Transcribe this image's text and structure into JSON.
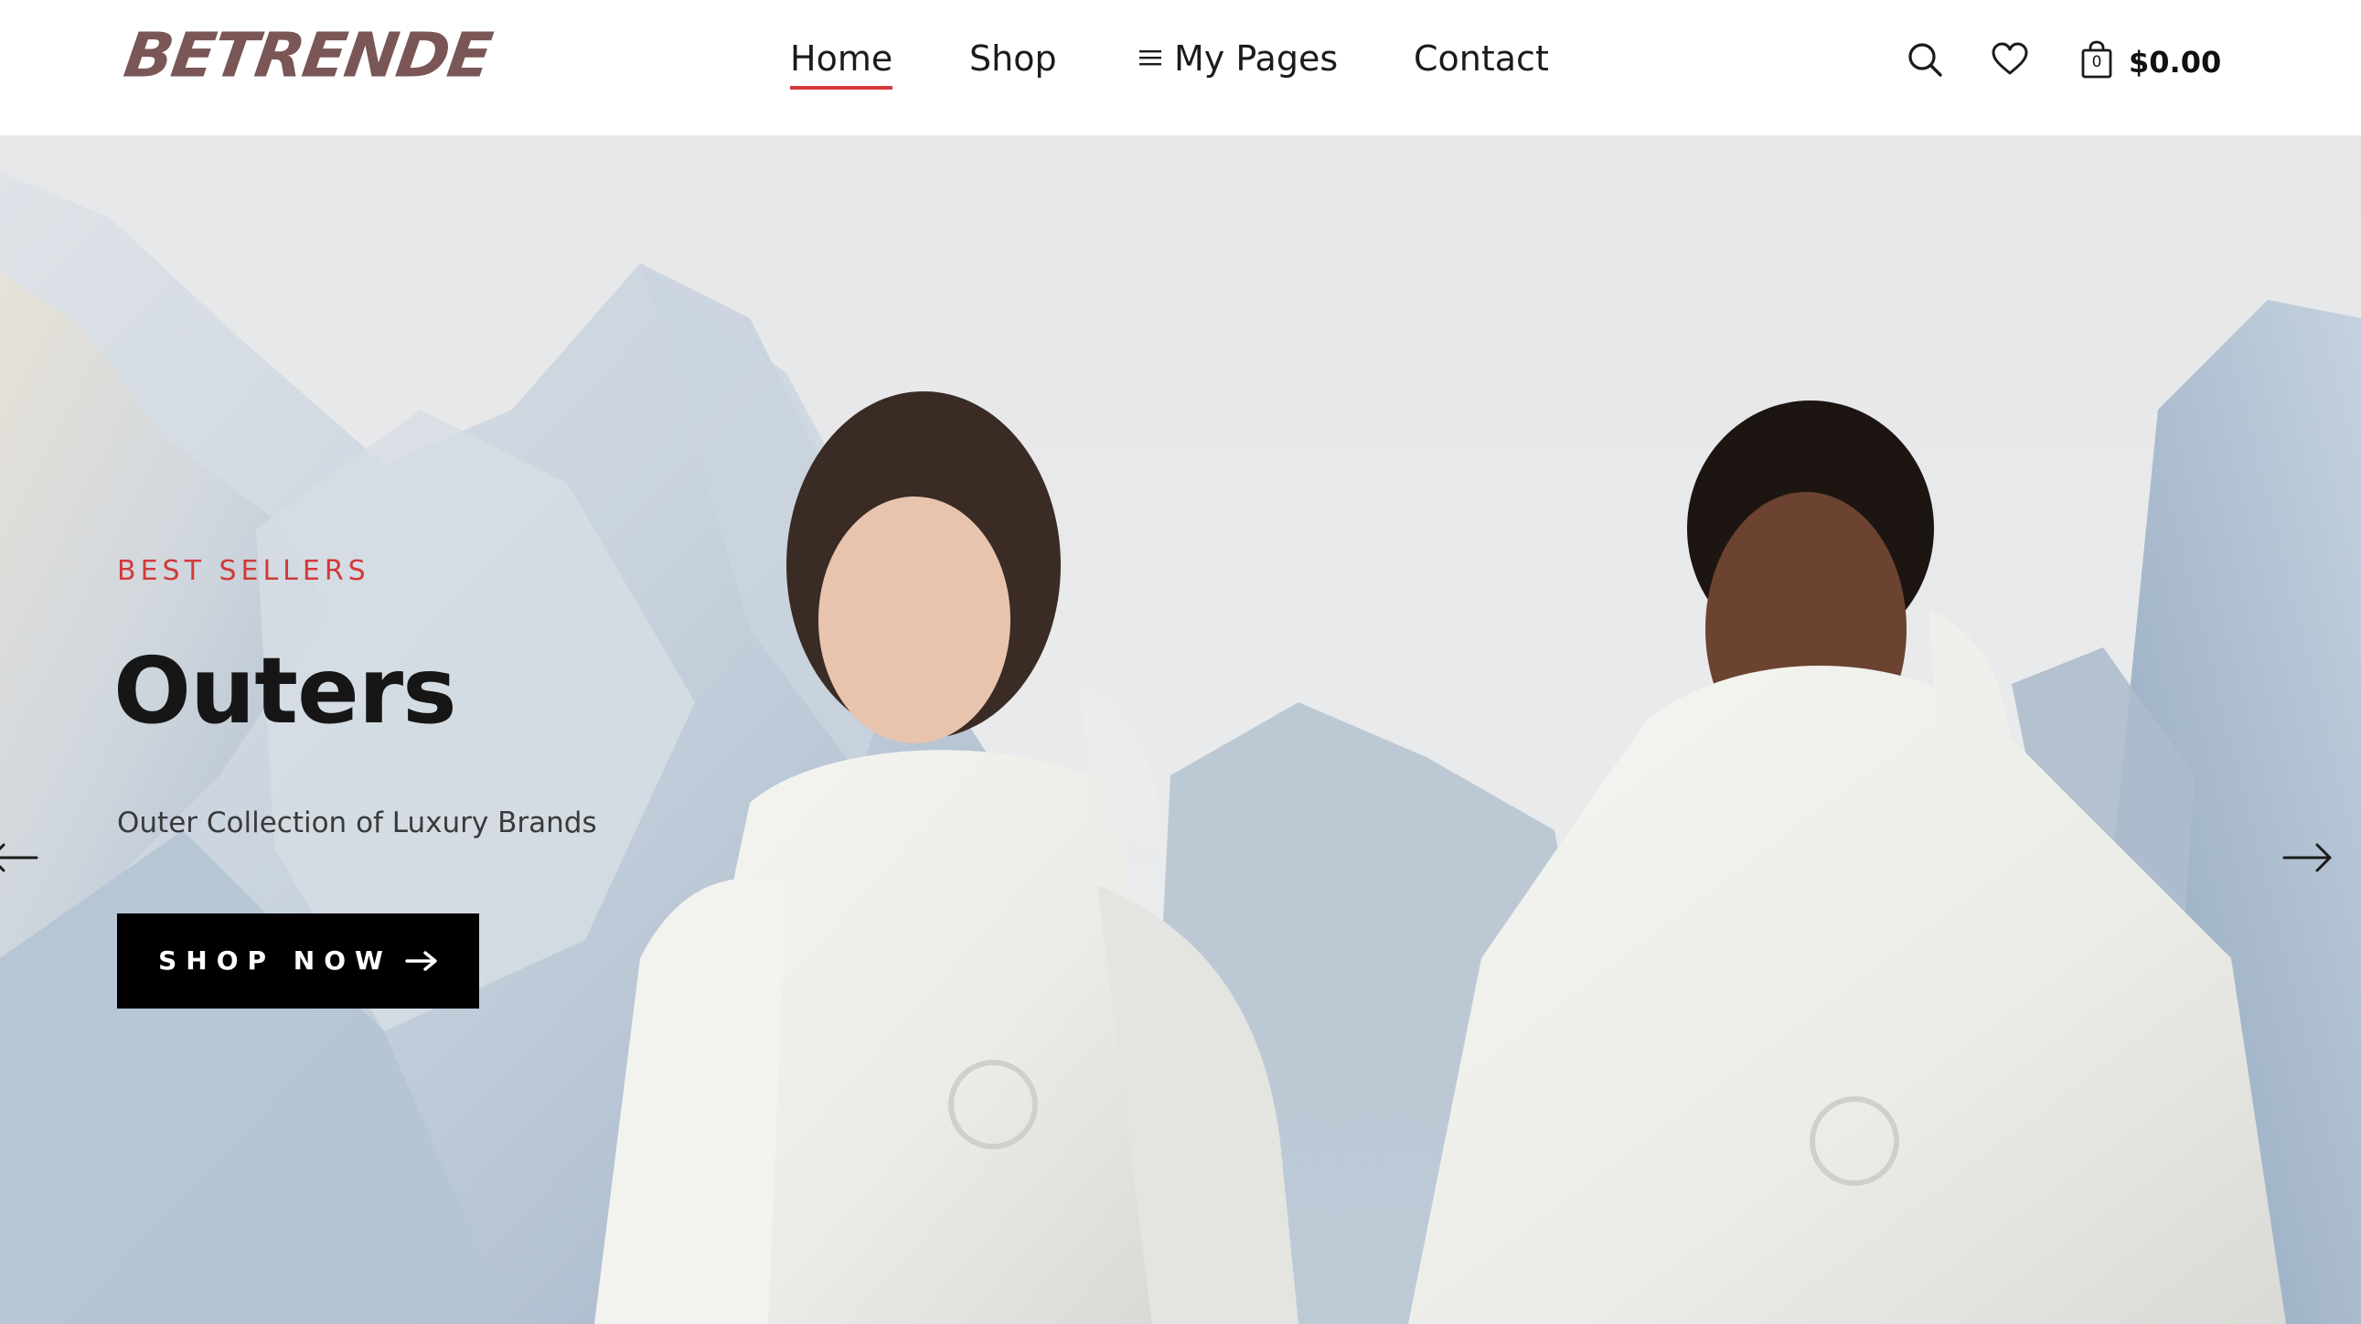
{
  "header": {
    "logo_text": "BETRENDE",
    "nav": [
      {
        "label": "Home",
        "active": true
      },
      {
        "label": "Shop",
        "active": false
      },
      {
        "label": "My Pages",
        "active": false,
        "icon": "menu-lines-icon"
      },
      {
        "label": "Contact",
        "active": false
      }
    ],
    "icons": [
      "search-icon",
      "heart-icon",
      "shopping-bag-icon"
    ],
    "cart_count": "0",
    "cart_total": "$0.00"
  },
  "hero": {
    "eyebrow": "BEST SELLERS",
    "title": "Outers",
    "subtitle": "Outer Collection of Luxury Brands",
    "cta_label": "SHOP NOW",
    "prev_icon": "arrow-left-icon",
    "next_icon": "arrow-right-icon"
  },
  "colors": {
    "logo": "#7a5656",
    "accent": "#d8393b",
    "eyebrow": "#d23a3a",
    "button_bg": "#000000",
    "button_text": "#ffffff",
    "hero_bg": "#e8e9eb"
  }
}
